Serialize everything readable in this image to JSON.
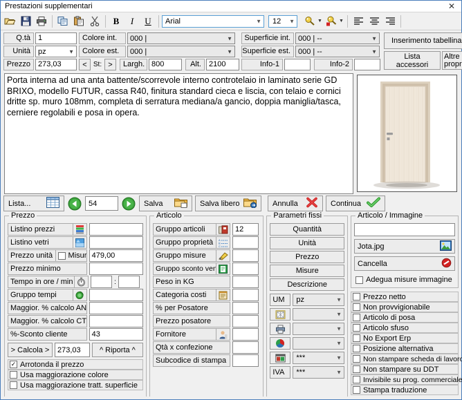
{
  "window": {
    "title": "Prestazioni supplementari",
    "close_label": "✕"
  },
  "toolbar": {
    "open_tip": "Apri",
    "save_tip": "Salva",
    "print_tip": "Stampa",
    "copy_tip": "Copia",
    "paste_tip": "Incolla",
    "cut_tip": "Taglia",
    "bold_label": "B",
    "italic_label": "I",
    "underline_label": "U",
    "font_name": "Arial",
    "font_size": "12",
    "align_left_tip": "Allinea a sinistra",
    "align_center_tip": "Centra",
    "align_right_tip": "Allinea a destra"
  },
  "header": {
    "qta_label": "Q.tà",
    "qta_value": "1",
    "unita_label": "Unità",
    "unita_value": "pz",
    "prezzo_label": "Prezzo",
    "prezzo_value": "273,03",
    "colore_int_label": "Colore int.",
    "colore_int_value": "000 |",
    "colore_est_label": "Colore est.",
    "colore_est_value": "000 |",
    "st_prev": "<",
    "st_label": "St:",
    "st_next": ">",
    "largh_label": "Largh.",
    "largh_value": "800",
    "alt_label": "Alt.",
    "alt_value": "2100",
    "superficie_int_label": "Superficie int.",
    "superficie_int_value": "000 | --",
    "superficie_est_label": "Superficie est.",
    "superficie_est_value": "000 | --",
    "info1_label": "Info-1",
    "info1_value": "",
    "info2_label": "Info-2",
    "info2_value": "",
    "inserimento_tabellina": "Inserimento tabellina",
    "lista_accessori": "Lista accessori",
    "altre_proprieta": "Altre proprietà"
  },
  "description": {
    "text": "Porta interna ad una anta battente/scorrevole interno controtelaio in laminato serie GD BRIXO, modello FUTUR, cassa R40, finitura standard cieca e liscia, con telaio e cornici dritte sp. muro 108mm, completa di serratura mediana/a gancio, doppia maniglia/tasca, cerniere regolabili e posa in opera."
  },
  "preview": {
    "alt": "Anteprima porta"
  },
  "commands": {
    "lista_label": "Lista...",
    "prev_tip": "Precedente",
    "position_value": "54",
    "next_tip": "Successivo",
    "salva_label": "Salva",
    "salva_libero_label": "Salva libero",
    "annulla_label": "Annulla",
    "continua_label": "Continua"
  },
  "prezzo_panel": {
    "caption": "Prezzo",
    "rows": [
      {
        "label": "Listino prezzi",
        "icon": "price-list-icon",
        "value": ""
      },
      {
        "label": "Listino vetri",
        "icon": "glass-list-icon",
        "value": ""
      },
      {
        "label": "Prezzo unità",
        "icon": "",
        "value": "479,00"
      },
      {
        "label": "Prezzo minimo",
        "icon": "",
        "value": ""
      },
      {
        "label": "Tempo in ore / min",
        "icon": "stopwatch-icon",
        "value": ""
      },
      {
        "label": "Gruppo tempi",
        "icon": "time-group-icon",
        "value": ""
      },
      {
        "label": "Maggior. % calcolo ANL",
        "icon": "",
        "value": ""
      },
      {
        "label": "Maggior. % calcolo CTB",
        "icon": "",
        "value": ""
      },
      {
        "label": "%-Sconto cliente",
        "icon": "",
        "value": "43"
      }
    ],
    "misure_label": "Misure",
    "misure_checked": false,
    "tempo_sep": ":",
    "tempo_h": "",
    "tempo_m": "",
    "calcola_label": "> Calcola >",
    "calcola_value": "273,03",
    "riporta_label": "^ Riporta ^",
    "checks": [
      {
        "label": "Arrotonda il prezzo",
        "checked": true
      },
      {
        "label": "Usa maggiorazione colore",
        "checked": false
      },
      {
        "label": "Usa maggiorazione tratt. superficie",
        "checked": false
      }
    ]
  },
  "articolo_panel": {
    "caption": "Articolo",
    "rows": [
      {
        "label": "Gruppo articoli",
        "icon": "article-group-icon",
        "value": "12"
      },
      {
        "label": "Gruppo proprietà",
        "icon": "property-group-icon",
        "value": ""
      },
      {
        "label": "Gruppo misure",
        "icon": "measure-group-icon",
        "value": ""
      },
      {
        "label": "Gruppo sconto vendita",
        "icon": "discount-group-icon",
        "value": ""
      },
      {
        "label": "Peso in KG",
        "icon": "",
        "value": ""
      },
      {
        "label": "Categoria costi",
        "icon": "cost-category-icon",
        "value": ""
      },
      {
        "label": "% per Posatore",
        "icon": "",
        "value": ""
      },
      {
        "label": "Prezzo posatore",
        "icon": "",
        "value": ""
      },
      {
        "label": "Fornitore",
        "icon": "supplier-icon",
        "value": ""
      },
      {
        "label": "Qtà x confezione",
        "icon": "",
        "value": ""
      },
      {
        "label": "Subcodice di stampa",
        "icon": "",
        "value": ""
      }
    ]
  },
  "parametri_panel": {
    "caption": "Parametri fissi",
    "buttons": [
      "Quantità",
      "Unità",
      "Prezzo",
      "Misure",
      "Descrizione"
    ],
    "combos": [
      {
        "icon": "um-label",
        "label": "UM",
        "value": "pz"
      },
      {
        "icon": "window-icon",
        "label": "",
        "value": ""
      },
      {
        "icon": "printer-icon",
        "label": "",
        "value": ""
      },
      {
        "icon": "color-wheel-icon",
        "label": "",
        "value": ""
      },
      {
        "icon": "catalog-icon",
        "label": "",
        "value": "***"
      },
      {
        "icon": "iva-label",
        "label": "IVA",
        "value": "***"
      }
    ]
  },
  "immagine_panel": {
    "caption": "Articolo / Immagine",
    "path_value": "",
    "file_label": "Jota.jpg",
    "cancella_label": "Cancella",
    "adegua_label": "Adegua misure immagine",
    "adegua_checked": false
  },
  "flags_panel": {
    "items": [
      {
        "label": "Prezzo netto",
        "checked": false
      },
      {
        "label": "Non provvigionabile",
        "checked": false
      },
      {
        "label": "Articolo di posa",
        "checked": false
      },
      {
        "label": "Articolo sfuso",
        "checked": false
      },
      {
        "label": "No Export Erp",
        "checked": false
      },
      {
        "label": "Posizione alternativa",
        "checked": false
      },
      {
        "label": "Non stampare scheda di lavoro",
        "checked": false
      },
      {
        "label": "Non stampare su DDT",
        "checked": false
      },
      {
        "label": "Invisibile su prog. commerciale",
        "checked": false
      },
      {
        "label": "Stampa traduzione",
        "checked": false
      }
    ]
  },
  "colors": {
    "window_border": "#4a7ebb",
    "face": "#f0f0f0",
    "field": "#ffffff",
    "label": "#ececec",
    "accent_green": "#3c9d3c",
    "accent_red": "#cc2222"
  }
}
